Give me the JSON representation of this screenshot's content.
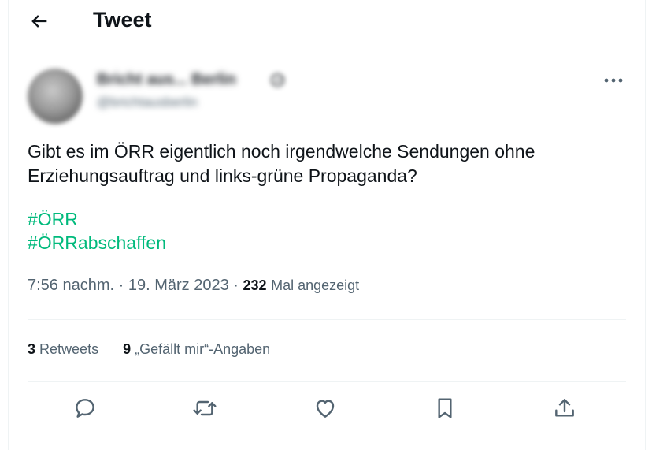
{
  "header": {
    "title": "Tweet"
  },
  "author": {
    "display_name": "Bricht aus... Berlin",
    "emoji": "😥",
    "handle": "@brichtausberlin"
  },
  "tweet": {
    "text_line1": "Gibt es im ÖRR eigentlich noch irgendwelche Sendungen ohne",
    "text_line2": "Erziehungsauftrag und links-grüne Propaganda?",
    "hashtags": [
      "#ÖRR",
      "#ÖRRabschaffen"
    ],
    "time": "7:56 nachm.",
    "separator": " · ",
    "date": "19. März 2023",
    "views_count": "232",
    "views_label": "Mal angezeigt"
  },
  "stats": {
    "retweets_count": "3",
    "retweets_label": "Retweets",
    "likes_count": "9",
    "likes_label": "„Gefällt mir“-Angaben"
  },
  "icons": {
    "back": "arrow-left-icon",
    "more": "more-horizontal-icon",
    "reply": "reply-icon",
    "retweet": "retweet-icon",
    "like": "heart-icon",
    "bookmark": "bookmark-icon",
    "share": "share-icon"
  },
  "colors": {
    "hashtag": "#00ba7c",
    "secondary_text": "#536471",
    "primary_text": "#0f1419"
  }
}
